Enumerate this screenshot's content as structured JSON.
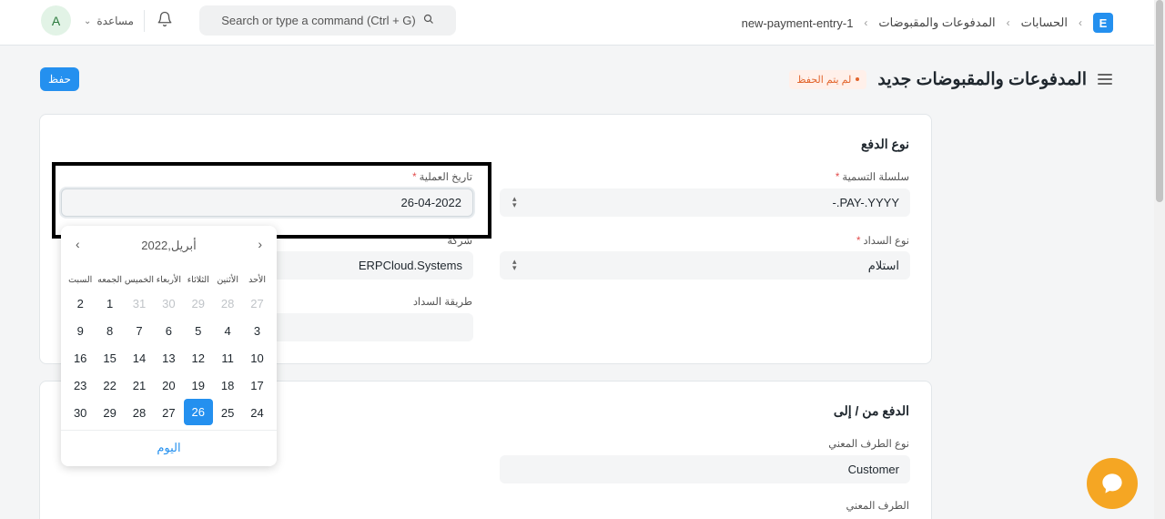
{
  "navbar": {
    "avatar_initial": "A",
    "help_label": "مساعدة",
    "search_placeholder": "Search or type a command (Ctrl + G)",
    "breadcrumb": [
      "الحسابات",
      "المدفوعات والمقبوضات",
      "new-payment-entry-1"
    ],
    "logo_letter": "E"
  },
  "page": {
    "title": "المدفوعات والمقبوضات جديد",
    "status": "لم يتم الحفظ",
    "save_label": "حفظ"
  },
  "section1": {
    "title": "نوع الدفع",
    "naming_series_label": "سلسلة التسمية",
    "naming_series_value": "-.PAY-.YYYY",
    "payment_type_label": "نوع السداد",
    "payment_type_value": "استلام",
    "posting_date_label": "تاريخ العملية",
    "posting_date_value": "26-04-2022",
    "company_label": "شركة",
    "company_value": "ERPCloud.Systems",
    "mode_of_payment_label": "طريقة السداد",
    "mode_of_payment_value": ""
  },
  "section2": {
    "title": "الدفع من / إلى",
    "party_type_label": "نوع الطرف المعني",
    "party_type_value": "Customer",
    "party_label": "الطرف المعني"
  },
  "datepicker": {
    "month_label": "أبريل,2022",
    "weekdays": [
      "الأحد",
      "الأثنين",
      "الثلاثاء",
      "الأربعاء",
      "الخميس",
      "الجمعه",
      "السبت"
    ],
    "weeks": [
      [
        "27",
        "28",
        "29",
        "30",
        "31",
        "1",
        "2"
      ],
      [
        "3",
        "4",
        "5",
        "6",
        "7",
        "8",
        "9"
      ],
      [
        "10",
        "11",
        "12",
        "13",
        "14",
        "15",
        "16"
      ],
      [
        "17",
        "18",
        "19",
        "20",
        "21",
        "22",
        "23"
      ],
      [
        "24",
        "25",
        "26",
        "27",
        "28",
        "29",
        "30"
      ]
    ],
    "selected_day": "26",
    "today_label": "اليوم"
  },
  "colors": {
    "primary": "#2490ef",
    "status_orange": "#e2652d",
    "chat": "#f5a623"
  }
}
